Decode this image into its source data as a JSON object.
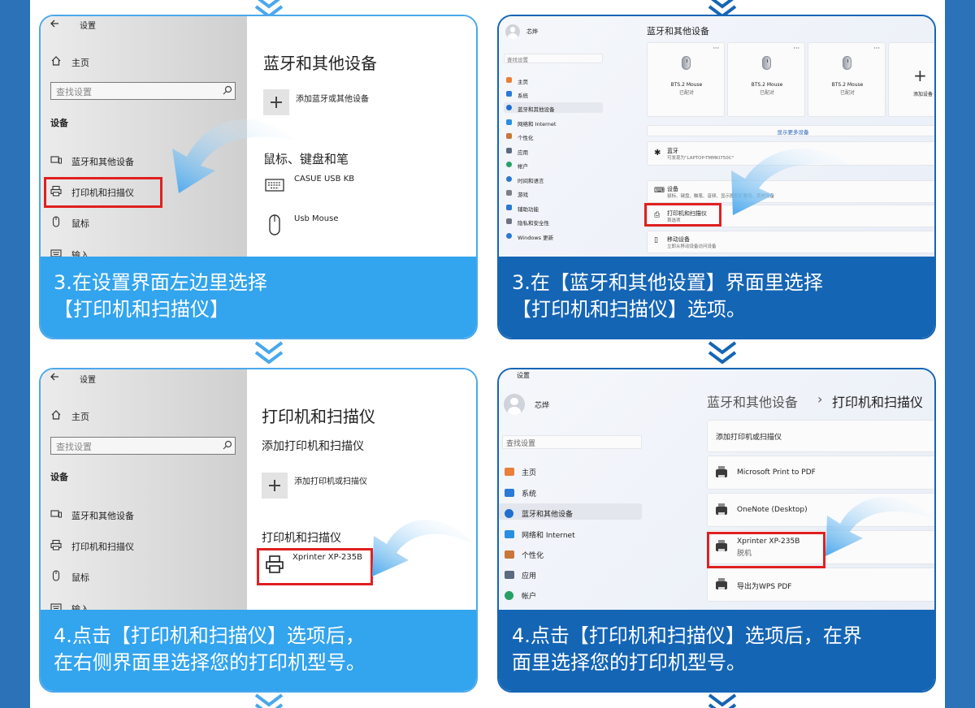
{
  "colors": {
    "frame": "#2b72b9",
    "caption_light": "#33a4ee",
    "caption_dark": "#1565b5",
    "highlight": "#e02020",
    "arrow": "#4aa8ec"
  },
  "card1": {
    "back_label": "设置",
    "home": "主页",
    "search_placeholder": "查找设置",
    "section": "设备",
    "nav": [
      "蓝牙和其他设备",
      "打印机和扫描仪",
      "鼠标",
      "输入"
    ],
    "title": "蓝牙和其他设备",
    "add_label": "添加蓝牙或其他设备",
    "group_title": "鼠标、键盘和笔",
    "devices": [
      "CASUE USB KB",
      "Usb Mouse"
    ],
    "caption_line1": "3.在设置界面左边里选择",
    "caption_line2": "【打印机和扫描仪】"
  },
  "card2": {
    "user": "芯烨",
    "title": "蓝牙和其他设备",
    "search_placeholder": "查找设置",
    "nav": [
      "主页",
      "系统",
      "蓝牙和其他设备",
      "网络和 Internet",
      "个性化",
      "应用",
      "帐户",
      "时间和语言",
      "游戏",
      "辅助功能",
      "隐私和安全性",
      "Windows 更新"
    ],
    "mice": [
      {
        "name": "BTS.2 Mouse",
        "status": "已配对"
      },
      {
        "name": "BTS.2 Mouse",
        "status": "已配对"
      },
      {
        "name": "BTS.2 Mouse",
        "status": "已配对"
      }
    ],
    "add_device": "添加设备",
    "more": "显示更多设备",
    "bt_title": "蓝牙",
    "bt_sub": "可发现为\"LAPTOP-TMMKI750C\"",
    "rows": [
      {
        "title": "设备",
        "sub": "鼠标、键盘、触笔、音频、显示器和扩展坞、其他设备"
      },
      {
        "title": "打印机和扫描仪",
        "sub": "首选项"
      },
      {
        "title": "移动设备",
        "sub": "立即从移动设备访问设备"
      }
    ],
    "caption_line1": "3.在【蓝牙和其他设置】界面里选择",
    "caption_line2": "【打印机和扫描仪】选项。"
  },
  "card3": {
    "back_label": "设置",
    "home": "主页",
    "search_placeholder": "查找设置",
    "section": "设备",
    "nav": [
      "蓝牙和其他设备",
      "打印机和扫描仪",
      "鼠标",
      "输入"
    ],
    "title": "打印机和扫描仪",
    "add_title": "添加打印机和扫描仪",
    "add_label": "添加打印机或扫描仪",
    "group_title": "打印机和扫描仪",
    "printer": "Xprinter XP-235B",
    "caption_line1": "4.点击【打印机和扫描仪】选项后，",
    "caption_line2": "在右侧界面里选择您的打印机型号。"
  },
  "card4": {
    "window_title": "设置",
    "user": "芯烨",
    "search_placeholder": "查找设置",
    "nav": [
      "主页",
      "系统",
      "蓝牙和其他设备",
      "网络和 Internet",
      "个性化",
      "应用",
      "帐户"
    ],
    "breadcrumb_parent": "蓝牙和其他设备",
    "breadcrumb_sep": "›",
    "breadcrumb_current": "打印机和扫描仪",
    "add_label": "添加打印机或扫描仪",
    "printers": [
      {
        "name": "Microsoft Print to PDF",
        "status": ""
      },
      {
        "name": "OneNote (Desktop)",
        "status": ""
      },
      {
        "name": "Xprinter XP-235B",
        "status": "脱机"
      },
      {
        "name": "导出为WPS PDF",
        "status": ""
      }
    ],
    "caption_line1": "4.点击【打印机和扫描仪】选项后，在界",
    "caption_line2": "面里选择您的打印机型号。"
  }
}
